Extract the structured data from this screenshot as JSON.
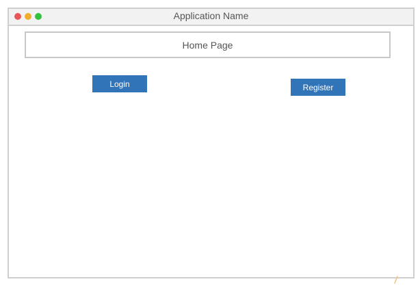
{
  "window": {
    "title": "Application Name",
    "controls": {
      "close_color": "#e8575a",
      "minimize_color": "#f2ad2f",
      "zoom_color": "#35c13f"
    }
  },
  "header": {
    "title": "Home Page"
  },
  "actions": {
    "login_label": "Login",
    "register_label": "Register",
    "button_color": "#3274b8"
  },
  "colors": {
    "corner_accent": "#f2c27a"
  }
}
